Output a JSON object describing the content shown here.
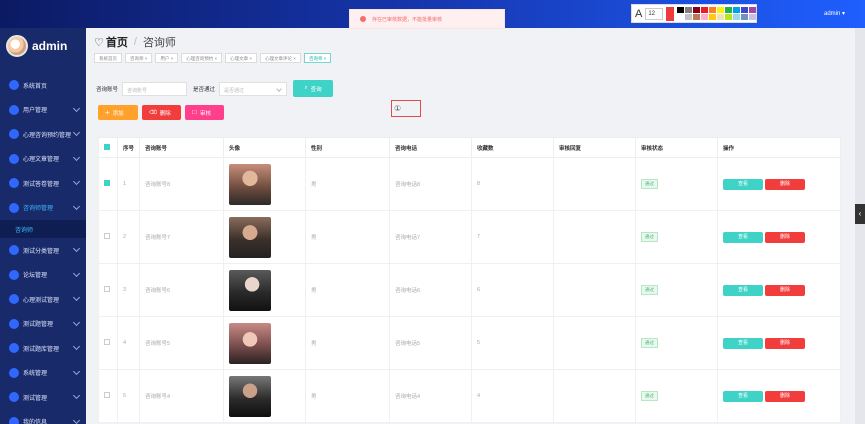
{
  "app": {
    "brand": "admin",
    "user_menu": "admin ▾"
  },
  "toast": {
    "message": "存在已审核数据，不能批量审核"
  },
  "palette": {
    "font_size": "12",
    "current_color": "#ee3b3b",
    "colors": [
      "#000000",
      "#7f7f7f",
      "#880015",
      "#ed1c24",
      "#ff7f27",
      "#fff200",
      "#22b14c",
      "#00a2e8",
      "#3f48cc",
      "#a349a4",
      "#ffffff",
      "#c3c3c3",
      "#b97a57",
      "#ffaec9",
      "#ffc90e",
      "#efe4b0",
      "#b5e61d",
      "#99d9ea",
      "#7092be",
      "#c8bfe7"
    ]
  },
  "sidebar": {
    "items": [
      {
        "label": "系统首页",
        "has_sub": false
      },
      {
        "label": "用户管理",
        "has_sub": true
      },
      {
        "label": "心理咨询预约管理",
        "has_sub": true
      },
      {
        "label": "心理文章管理",
        "has_sub": true
      },
      {
        "label": "测试答卷管理",
        "has_sub": true
      },
      {
        "label": "咨询师管理",
        "has_sub": true,
        "active": true
      },
      {
        "label": "测试分类管理",
        "has_sub": true
      },
      {
        "label": "论坛管理",
        "has_sub": true
      },
      {
        "label": "心理测试管理",
        "has_sub": true
      },
      {
        "label": "测试题管理",
        "has_sub": true
      },
      {
        "label": "测试题库管理",
        "has_sub": true
      },
      {
        "label": "系统管理",
        "has_sub": true
      },
      {
        "label": "测试管理",
        "has_sub": true
      },
      {
        "label": "我的信息",
        "has_sub": true
      }
    ],
    "sub_active": "咨询师"
  },
  "breadcrumb": {
    "home": "首页",
    "current": "咨询师"
  },
  "tags": [
    {
      "label": "系统首页",
      "active": false
    },
    {
      "label": "咨询师 ×",
      "active": false
    },
    {
      "label": "用户 ×",
      "active": false
    },
    {
      "label": "心理咨询预约 ×",
      "active": false
    },
    {
      "label": "心理文章 ×",
      "active": false
    },
    {
      "label": "心理文章评论 ×",
      "active": false
    },
    {
      "label": "咨询师 ×",
      "active": true
    }
  ],
  "search": {
    "account_label": "咨询账号",
    "account_placeholder": "咨询账号",
    "passed_label": "是否通过",
    "passed_placeholder": "是否通过",
    "button": "查询"
  },
  "actions": {
    "add": "添加",
    "delete": "删除",
    "audit": "审核"
  },
  "annotation": "①",
  "table": {
    "headers": [
      "序号",
      "咨询账号",
      "头像",
      "性别",
      "咨询电话",
      "收藏数",
      "审核回复",
      "审核状态",
      "操作"
    ],
    "rows": [
      {
        "index": "1",
        "account": "咨询账号8",
        "gender": "男",
        "phone": "咨询电话8",
        "favorites": "8",
        "reply": "",
        "status": "通过",
        "checked": true
      },
      {
        "index": "2",
        "account": "咨询账号7",
        "gender": "男",
        "phone": "咨询电话7",
        "favorites": "7",
        "reply": "",
        "status": "通过",
        "checked": false
      },
      {
        "index": "3",
        "account": "咨询账号6",
        "gender": "男",
        "phone": "咨询电话6",
        "favorites": "6",
        "reply": "",
        "status": "通过",
        "checked": false
      },
      {
        "index": "4",
        "account": "咨询账号5",
        "gender": "男",
        "phone": "咨询电话5",
        "favorites": "5",
        "reply": "",
        "status": "通过",
        "checked": false
      },
      {
        "index": "5",
        "account": "咨询账号4",
        "gender": "男",
        "phone": "咨询电话4",
        "favorites": "4",
        "reply": "",
        "status": "通过",
        "checked": false
      }
    ],
    "view_label": "查看",
    "delete_label": "删除"
  },
  "right_tab": "‹"
}
